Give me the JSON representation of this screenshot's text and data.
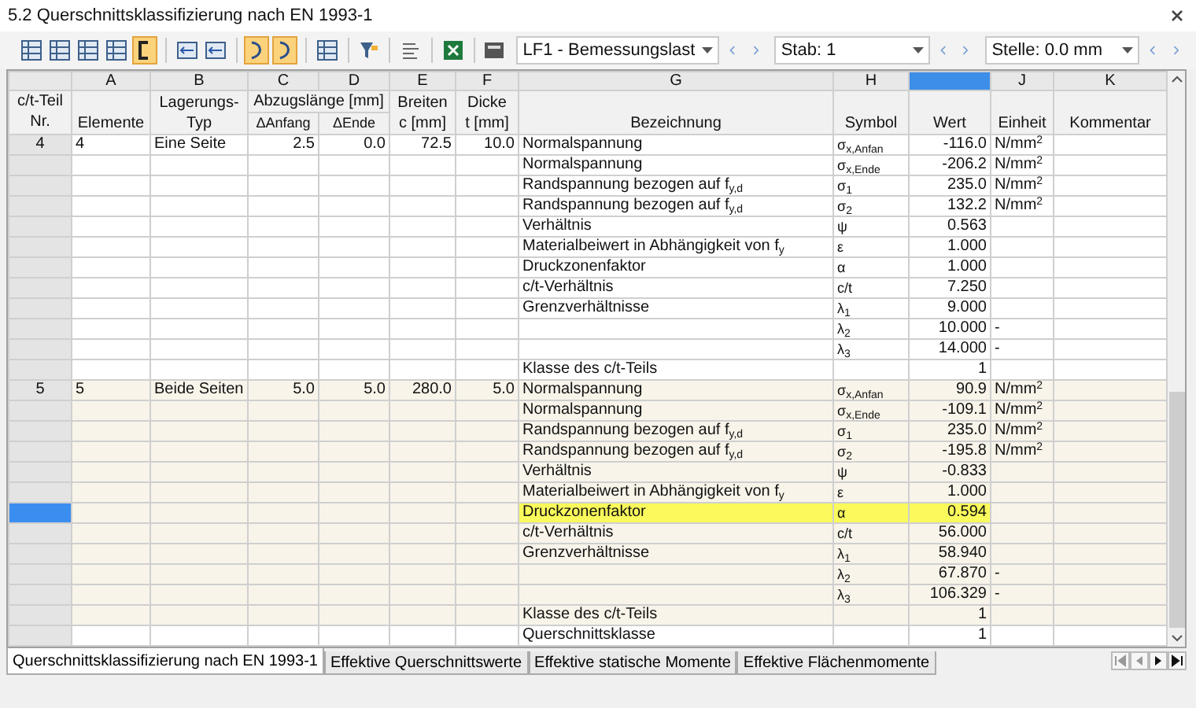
{
  "window": {
    "title": "5.2 Querschnittsklassifizierung nach EN 1993-1"
  },
  "toolbar": {
    "groups": [
      [
        {
          "kind": "grid",
          "active": false
        },
        {
          "kind": "grid",
          "active": false
        },
        {
          "kind": "grid",
          "active": false
        },
        {
          "kind": "grid",
          "active": false
        },
        {
          "kind": "bracket",
          "active": true
        }
      ],
      [
        {
          "kind": "arrow",
          "active": false
        },
        {
          "kind": "arrow",
          "active": false
        }
      ],
      [
        {
          "kind": "curve",
          "active": true
        },
        {
          "kind": "curve",
          "active": true
        }
      ],
      [
        {
          "kind": "grid",
          "active": false
        }
      ],
      [
        {
          "kind": "filter",
          "active": false
        }
      ],
      [
        {
          "kind": "list",
          "active": false
        }
      ],
      [
        {
          "kind": "excel",
          "active": false
        }
      ],
      [
        {
          "kind": "calc",
          "active": false
        }
      ]
    ],
    "selects": [
      {
        "value": "LF1 - Bemessungslast"
      },
      {
        "value": "Stab: 1"
      },
      {
        "value": "Stelle: 0.0 mm"
      }
    ]
  },
  "table": {
    "corner_lines": [
      "c/t-Teil",
      "Nr."
    ],
    "span_label": "Abzugslänge [mm]",
    "columns": [
      {
        "letter": "A",
        "lines": [
          "Elemente"
        ],
        "selected": false
      },
      {
        "letter": "B",
        "lines": [
          "Lagerungs-",
          "Typ"
        ],
        "selected": false
      },
      {
        "letter": "C",
        "sub": "ΔAnfang",
        "selected": false
      },
      {
        "letter": "D",
        "sub": "ΔEnde",
        "selected": false
      },
      {
        "letter": "E",
        "lines": [
          "Breiten",
          "c [mm]"
        ],
        "selected": false
      },
      {
        "letter": "F",
        "lines": [
          "Dicke",
          "t [mm]"
        ],
        "selected": false
      },
      {
        "letter": "G",
        "lines": [
          "Bezeichnung"
        ],
        "selected": false
      },
      {
        "letter": "H",
        "lines": [
          "Symbol"
        ],
        "selected": false
      },
      {
        "lines": [
          "Wert"
        ],
        "selected": true
      },
      {
        "letter": "J",
        "lines": [
          "Einheit"
        ],
        "selected": false
      },
      {
        "letter": "K",
        "lines": [
          "Kommentar"
        ],
        "selected": false
      }
    ],
    "groups": [
      {
        "nr": "4",
        "element": "4",
        "type": "Eine Seite",
        "start": "2.5",
        "end": "0.0",
        "c": "72.5",
        "t": "10.0",
        "selected": false,
        "rows": [
          {
            "kind": "value",
            "label": "Normalspannung",
            "symbol": "σ$_{x,Anfan}$",
            "value": "-116.0",
            "unit": "N/mm$^{2}$",
            "selected": false,
            "highlighted": false
          },
          {
            "kind": "value",
            "label": "Normalspannung",
            "symbol": "σ$_{x,Ende}$",
            "value": "-206.2",
            "unit": "N/mm$^{2}$",
            "selected": false,
            "highlighted": false
          },
          {
            "kind": "value",
            "label": "Randspannung bezogen auf f$_{y,d}$",
            "symbol": "σ$_{1}$",
            "value": "235.0",
            "unit": "N/mm$^{2}$",
            "selected": false,
            "highlighted": false
          },
          {
            "kind": "value",
            "label": "Randspannung bezogen auf f$_{y,d}$",
            "symbol": "σ$_{2}$",
            "value": "132.2",
            "unit": "N/mm$^{2}$",
            "selected": false,
            "highlighted": false
          },
          {
            "kind": "value",
            "label": "Verhältnis",
            "symbol": "ψ",
            "value": "0.563",
            "selected": false,
            "highlighted": false
          },
          {
            "kind": "value",
            "label": "Materialbeiwert in Abhängigkeit von f$_{y}$",
            "symbol": "ε",
            "value": "1.000",
            "selected": false,
            "highlighted": false
          },
          {
            "kind": "value",
            "label": "Druckzonenfaktor",
            "symbol": "α",
            "value": "1.000",
            "selected": false,
            "highlighted": false
          },
          {
            "kind": "value",
            "label": "c/t-Verhältnis",
            "symbol": "c/t",
            "value": "7.250",
            "selected": false,
            "highlighted": false
          },
          {
            "kind": "value",
            "label": "Grenzverhältnisse",
            "symbol": "λ$_{1}$",
            "value": "9.000",
            "selected": false,
            "highlighted": false
          },
          {
            "kind": "value",
            "symbol": "λ$_{2}$",
            "value": "10.000",
            "unit": "-",
            "selected": false,
            "highlighted": false
          },
          {
            "kind": "value",
            "symbol": "λ$_{3}$",
            "value": "14.000",
            "unit": "-",
            "selected": false,
            "highlighted": false
          },
          {
            "kind": "value",
            "label": "Klasse des c/t-Teils",
            "value": "1",
            "selected": false,
            "highlighted": false
          }
        ]
      },
      {
        "nr": "5",
        "element": "5",
        "type": "Beide Seiten",
        "start": "5.0",
        "end": "5.0",
        "c": "280.0",
        "t": "5.0",
        "selected": true,
        "rows": [
          {
            "kind": "value",
            "label": "Normalspannung",
            "symbol": "σ$_{x,Anfan}$",
            "value": "90.9",
            "unit": "N/mm$^{2}$",
            "selected": false,
            "highlighted": false
          },
          {
            "kind": "value",
            "label": "Normalspannung",
            "symbol": "σ$_{x,Ende}$",
            "value": "-109.1",
            "unit": "N/mm$^{2}$",
            "selected": false,
            "highlighted": false
          },
          {
            "kind": "value",
            "label": "Randspannung bezogen auf f$_{y,d}$",
            "symbol": "σ$_{1}$",
            "value": "235.0",
            "unit": "N/mm$^{2}$",
            "selected": false,
            "highlighted": false
          },
          {
            "kind": "value",
            "label": "Randspannung bezogen auf f$_{y,d}$",
            "symbol": "σ$_{2}$",
            "value": "-195.8",
            "unit": "N/mm$^{2}$",
            "selected": false,
            "highlighted": false
          },
          {
            "kind": "value",
            "label": "Verhältnis",
            "symbol": "ψ",
            "value": "-0.833",
            "selected": false,
            "highlighted": false
          },
          {
            "kind": "value",
            "label": "Materialbeiwert in Abhängigkeit von f$_{y}$",
            "symbol": "ε",
            "value": "1.000",
            "selected": false,
            "highlighted": false
          },
          {
            "kind": "value",
            "label": "Druckzonenfaktor",
            "symbol": "α",
            "value": "0.594",
            "selected": true,
            "highlighted": true
          },
          {
            "kind": "value",
            "label": "c/t-Verhältnis",
            "symbol": "c/t",
            "value": "56.000",
            "selected": false,
            "highlighted": false
          },
          {
            "kind": "value",
            "label": "Grenzverhältnisse",
            "symbol": "λ$_{1}$",
            "value": "58.940",
            "selected": false,
            "highlighted": false
          },
          {
            "kind": "value",
            "symbol": "λ$_{2}$",
            "value": "67.870",
            "unit": "-",
            "selected": false,
            "highlighted": false
          },
          {
            "kind": "value",
            "symbol": "λ$_{3}$",
            "value": "106.329",
            "unit": "-",
            "selected": false,
            "highlighted": false
          },
          {
            "kind": "value",
            "label": "Klasse des c/t-Teils",
            "value": "1",
            "selected": false,
            "highlighted": false
          },
          {
            "kind": "summary",
            "label": "Querschnittsklasse",
            "value": "1",
            "selected": false,
            "highlighted": false
          }
        ]
      }
    ]
  },
  "tabs": [
    {
      "label": "Querschnittsklassifizierung nach EN 1993-1",
      "selected": true
    },
    {
      "label": "Effektive Querschnittswerte",
      "selected": false
    },
    {
      "label": "Effektive statische Momente",
      "selected": false
    },
    {
      "label": "Effektive Flächenmomente",
      "selected": false
    }
  ]
}
